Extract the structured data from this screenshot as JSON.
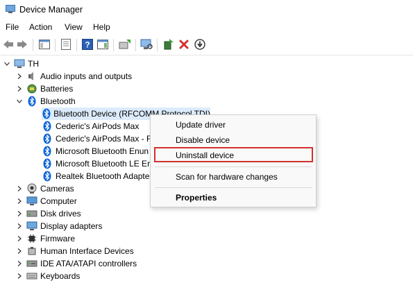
{
  "window": {
    "title": "Device Manager"
  },
  "menubar": {
    "items": [
      "File",
      "Action",
      "View",
      "Help"
    ]
  },
  "toolbar": {
    "buttons": [
      "back-arrow-icon",
      "forward-arrow-icon",
      "show-hide-console-tree-icon",
      "properties-icon",
      "help-icon",
      "show-action-pane-icon",
      "update-driver-icon",
      "scan-hardware-icon",
      "enable-device-icon",
      "uninstall-device-icon",
      "disable-device-icon"
    ],
    "colors": {
      "uninstall_red": "#d32f2f",
      "bluetooth_blue": "#0a64d8"
    }
  },
  "tree": {
    "root": "TH",
    "nodes": [
      {
        "label": "Audio inputs and outputs",
        "expanded": false
      },
      {
        "label": "Batteries",
        "expanded": false
      },
      {
        "label": "Bluetooth",
        "expanded": true
      },
      {
        "label": "Bluetooth Device (RFCOMM Protocol TDI)",
        "selected": true
      },
      {
        "label": "Cederic's AirPods Max"
      },
      {
        "label": "Cederic's AirPods Max - F"
      },
      {
        "label": "Microsoft Bluetooth Enun"
      },
      {
        "label": "Microsoft Bluetooth LE Er"
      },
      {
        "label": "Realtek Bluetooth Adapte"
      },
      {
        "label": "Cameras",
        "expanded": false
      },
      {
        "label": "Computer",
        "expanded": false
      },
      {
        "label": "Disk drives",
        "expanded": false
      },
      {
        "label": "Display adapters",
        "expanded": false
      },
      {
        "label": "Firmware",
        "expanded": false
      },
      {
        "label": "Human Interface Devices",
        "expanded": false
      },
      {
        "label": "IDE ATA/ATAPI controllers",
        "expanded": false
      },
      {
        "label": "Keyboards",
        "expanded": false
      }
    ]
  },
  "context_menu": {
    "items": [
      "Update driver",
      "Disable device",
      "Uninstall device",
      "Scan for hardware changes",
      "Properties"
    ],
    "highlighted": "Uninstall device",
    "highlight_color": "#d32f2f"
  }
}
